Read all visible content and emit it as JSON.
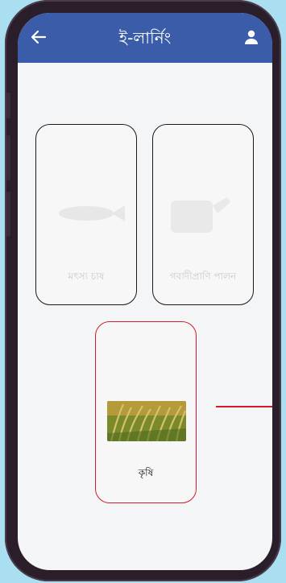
{
  "header": {
    "title": "ই-লার্নিং",
    "back_icon": "arrow-left-icon",
    "user_icon": "user-icon",
    "color": "#3b5ca8"
  },
  "cards": [
    {
      "label": "মৎস্য চাষ",
      "icon": "fish-image",
      "state": "faded"
    },
    {
      "label": "গবাদীপ্রাণি পালন",
      "icon": "cow-image",
      "state": "faded"
    },
    {
      "label": "কৃষি",
      "icon": "paddy-image",
      "state": "selected"
    }
  ],
  "accent_color": "#d41a2b"
}
